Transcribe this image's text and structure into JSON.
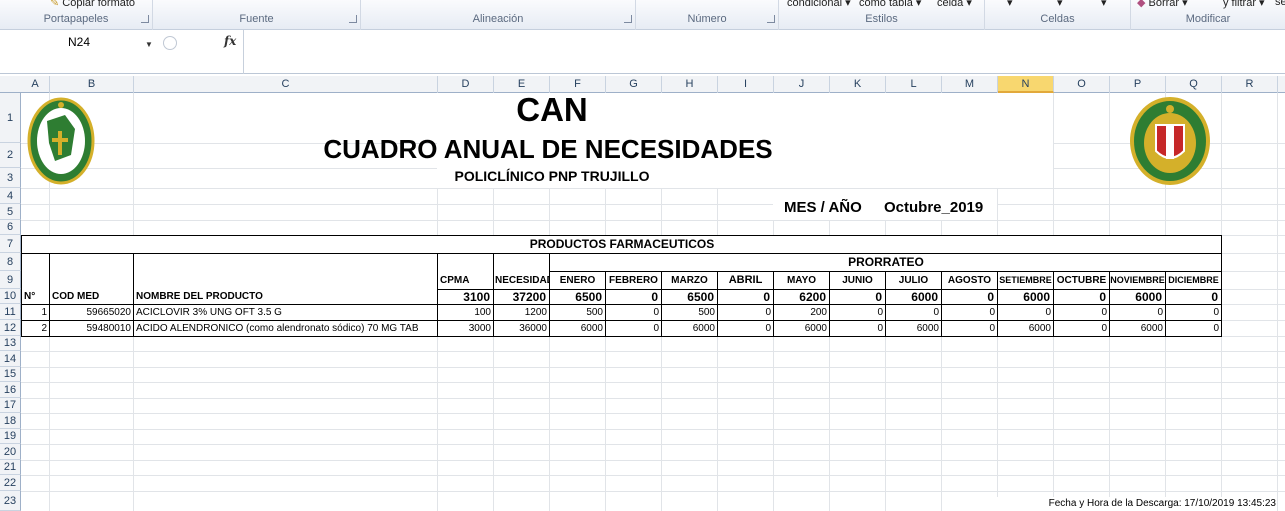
{
  "ribbon": {
    "groups": [
      "Portapapeles",
      "Fuente",
      "Alineación",
      "Número",
      "Estilos",
      "Celdas",
      "Modificar"
    ],
    "copy_format_label": "Copiar formato",
    "estilos_items": [
      "condicional ▾",
      "como tabla ▾",
      "celda ▾"
    ],
    "modificar_items": [
      "Borrar ▾",
      "y filtrar ▾",
      "se"
    ]
  },
  "formula_bar": {
    "name_box": "N24",
    "fx": "fx",
    "formula": ""
  },
  "columns": [
    "A",
    "B",
    "C",
    "D",
    "E",
    "F",
    "G",
    "H",
    "I",
    "J",
    "K",
    "L",
    "M",
    "N",
    "O",
    "P",
    "Q",
    "R"
  ],
  "selected_column": "N",
  "rows": [
    "1",
    "2",
    "3",
    "4",
    "5",
    "6",
    "7",
    "8",
    "9",
    "10",
    "11",
    "12",
    "13",
    "14",
    "15",
    "16",
    "17",
    "18",
    "19",
    "20",
    "21",
    "22",
    "23"
  ],
  "sheet": {
    "title": "CAN",
    "subtitle": "CUADRO ANUAL DE NECESIDADES",
    "institution": "POLICLÍNICO PNP TRUJILLO",
    "period_label": "MES / AÑO",
    "period_value": "Octubre_2019",
    "section_title": "PRODUCTOS FARMACEUTICOS",
    "prorrateo": "PRORRATEO",
    "headers": {
      "n": "N°",
      "cod": "COD MED",
      "name": "NOMBRE DEL PRODUCTO",
      "cpma": "CPMA",
      "necesidad": "NECESIDAD",
      "months": [
        "ENERO",
        "FEBRERO",
        "MARZO",
        "ABRIL",
        "MAYO",
        "JUNIO",
        "JULIO",
        "AGOSTO",
        "SETIEMBRE",
        "OCTUBRE",
        "NOVIEMBRE",
        "DICIEMBRE"
      ]
    },
    "totals": {
      "cpma": "3100",
      "necesidad": "37200",
      "months": [
        "6500",
        "0",
        "6500",
        "0",
        "6200",
        "0",
        "6000",
        "0",
        "6000",
        "0",
        "6000",
        "0"
      ]
    },
    "items": [
      {
        "n": "1",
        "cod": "59665020",
        "name": "ACICLOVIR 3% UNG OFT 3.5 G",
        "cpma": "100",
        "necesidad": "1200",
        "months": [
          "500",
          "0",
          "500",
          "0",
          "200",
          "0",
          "0",
          "0",
          "0",
          "0",
          "0",
          "0"
        ]
      },
      {
        "n": "2",
        "cod": "59480010",
        "name": "ACIDO ALENDRONICO (como alendronato sódico) 70 MG TAB",
        "cpma": "3000",
        "necesidad": "36000",
        "months": [
          "6000",
          "0",
          "6000",
          "0",
          "6000",
          "0",
          "6000",
          "0",
          "6000",
          "0",
          "6000",
          "0"
        ]
      }
    ],
    "download_note": "Fecha y Hora de la Descarga: 17/10/2019 13:45:23"
  },
  "colors": {
    "selected_header": "#f8d76f",
    "logo_green": "#2e7d32",
    "logo_gold": "#d4b02a",
    "logo_red": "#c62828"
  }
}
